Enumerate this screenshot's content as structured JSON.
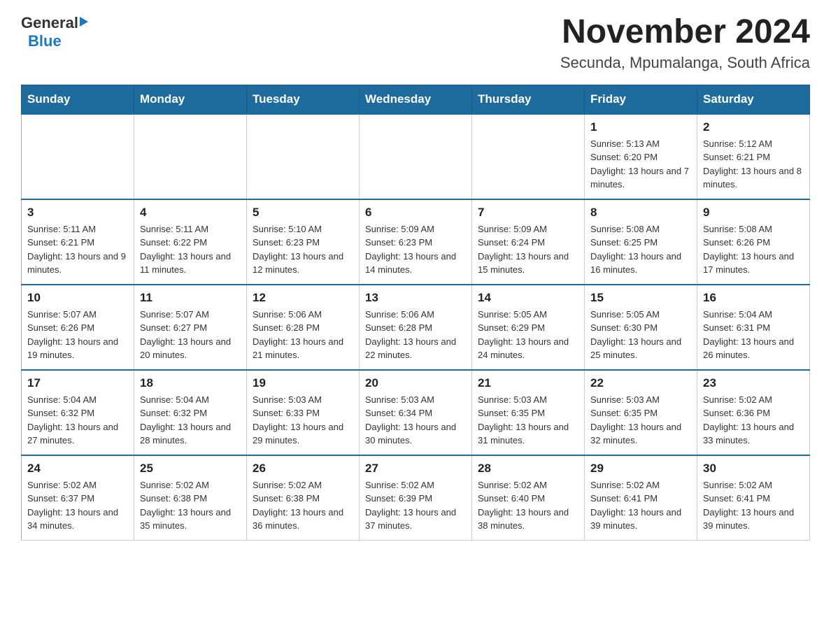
{
  "logo": {
    "general": "General",
    "blue": "Blue"
  },
  "title": "November 2024",
  "subtitle": "Secunda, Mpumalanga, South Africa",
  "headers": [
    "Sunday",
    "Monday",
    "Tuesday",
    "Wednesday",
    "Thursday",
    "Friday",
    "Saturday"
  ],
  "weeks": [
    [
      {
        "day": "",
        "info": ""
      },
      {
        "day": "",
        "info": ""
      },
      {
        "day": "",
        "info": ""
      },
      {
        "day": "",
        "info": ""
      },
      {
        "day": "",
        "info": ""
      },
      {
        "day": "1",
        "info": "Sunrise: 5:13 AM\nSunset: 6:20 PM\nDaylight: 13 hours and 7 minutes."
      },
      {
        "day": "2",
        "info": "Sunrise: 5:12 AM\nSunset: 6:21 PM\nDaylight: 13 hours and 8 minutes."
      }
    ],
    [
      {
        "day": "3",
        "info": "Sunrise: 5:11 AM\nSunset: 6:21 PM\nDaylight: 13 hours and 9 minutes."
      },
      {
        "day": "4",
        "info": "Sunrise: 5:11 AM\nSunset: 6:22 PM\nDaylight: 13 hours and 11 minutes."
      },
      {
        "day": "5",
        "info": "Sunrise: 5:10 AM\nSunset: 6:23 PM\nDaylight: 13 hours and 12 minutes."
      },
      {
        "day": "6",
        "info": "Sunrise: 5:09 AM\nSunset: 6:23 PM\nDaylight: 13 hours and 14 minutes."
      },
      {
        "day": "7",
        "info": "Sunrise: 5:09 AM\nSunset: 6:24 PM\nDaylight: 13 hours and 15 minutes."
      },
      {
        "day": "8",
        "info": "Sunrise: 5:08 AM\nSunset: 6:25 PM\nDaylight: 13 hours and 16 minutes."
      },
      {
        "day": "9",
        "info": "Sunrise: 5:08 AM\nSunset: 6:26 PM\nDaylight: 13 hours and 17 minutes."
      }
    ],
    [
      {
        "day": "10",
        "info": "Sunrise: 5:07 AM\nSunset: 6:26 PM\nDaylight: 13 hours and 19 minutes."
      },
      {
        "day": "11",
        "info": "Sunrise: 5:07 AM\nSunset: 6:27 PM\nDaylight: 13 hours and 20 minutes."
      },
      {
        "day": "12",
        "info": "Sunrise: 5:06 AM\nSunset: 6:28 PM\nDaylight: 13 hours and 21 minutes."
      },
      {
        "day": "13",
        "info": "Sunrise: 5:06 AM\nSunset: 6:28 PM\nDaylight: 13 hours and 22 minutes."
      },
      {
        "day": "14",
        "info": "Sunrise: 5:05 AM\nSunset: 6:29 PM\nDaylight: 13 hours and 24 minutes."
      },
      {
        "day": "15",
        "info": "Sunrise: 5:05 AM\nSunset: 6:30 PM\nDaylight: 13 hours and 25 minutes."
      },
      {
        "day": "16",
        "info": "Sunrise: 5:04 AM\nSunset: 6:31 PM\nDaylight: 13 hours and 26 minutes."
      }
    ],
    [
      {
        "day": "17",
        "info": "Sunrise: 5:04 AM\nSunset: 6:32 PM\nDaylight: 13 hours and 27 minutes."
      },
      {
        "day": "18",
        "info": "Sunrise: 5:04 AM\nSunset: 6:32 PM\nDaylight: 13 hours and 28 minutes."
      },
      {
        "day": "19",
        "info": "Sunrise: 5:03 AM\nSunset: 6:33 PM\nDaylight: 13 hours and 29 minutes."
      },
      {
        "day": "20",
        "info": "Sunrise: 5:03 AM\nSunset: 6:34 PM\nDaylight: 13 hours and 30 minutes."
      },
      {
        "day": "21",
        "info": "Sunrise: 5:03 AM\nSunset: 6:35 PM\nDaylight: 13 hours and 31 minutes."
      },
      {
        "day": "22",
        "info": "Sunrise: 5:03 AM\nSunset: 6:35 PM\nDaylight: 13 hours and 32 minutes."
      },
      {
        "day": "23",
        "info": "Sunrise: 5:02 AM\nSunset: 6:36 PM\nDaylight: 13 hours and 33 minutes."
      }
    ],
    [
      {
        "day": "24",
        "info": "Sunrise: 5:02 AM\nSunset: 6:37 PM\nDaylight: 13 hours and 34 minutes."
      },
      {
        "day": "25",
        "info": "Sunrise: 5:02 AM\nSunset: 6:38 PM\nDaylight: 13 hours and 35 minutes."
      },
      {
        "day": "26",
        "info": "Sunrise: 5:02 AM\nSunset: 6:38 PM\nDaylight: 13 hours and 36 minutes."
      },
      {
        "day": "27",
        "info": "Sunrise: 5:02 AM\nSunset: 6:39 PM\nDaylight: 13 hours and 37 minutes."
      },
      {
        "day": "28",
        "info": "Sunrise: 5:02 AM\nSunset: 6:40 PM\nDaylight: 13 hours and 38 minutes."
      },
      {
        "day": "29",
        "info": "Sunrise: 5:02 AM\nSunset: 6:41 PM\nDaylight: 13 hours and 39 minutes."
      },
      {
        "day": "30",
        "info": "Sunrise: 5:02 AM\nSunset: 6:41 PM\nDaylight: 13 hours and 39 minutes."
      }
    ]
  ]
}
